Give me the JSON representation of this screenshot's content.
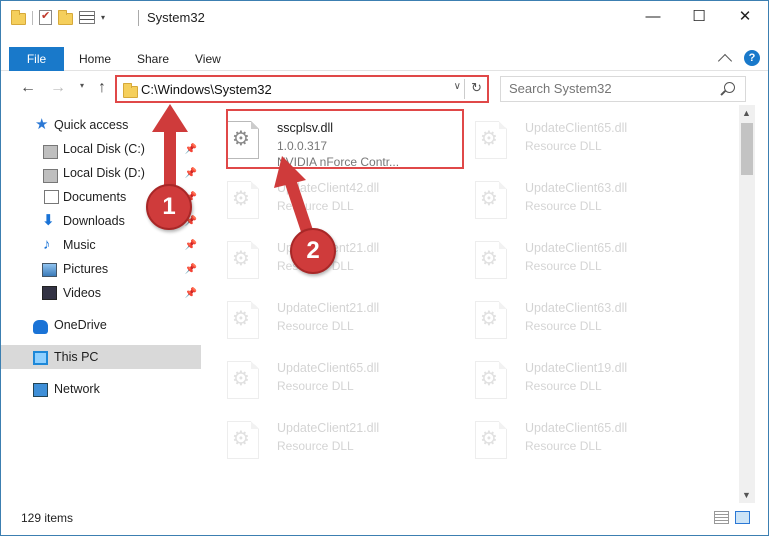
{
  "window": {
    "title": "System32"
  },
  "controls": {
    "minimize": "—",
    "maximize": "☐",
    "close": "✕"
  },
  "ribbon": {
    "tabs": [
      "File",
      "Home",
      "Share",
      "View"
    ],
    "help": "?"
  },
  "nav": {
    "back": "←",
    "forward": "→",
    "up": "↑",
    "dropdown": "▾"
  },
  "address": {
    "path": "C:\\Windows\\System32",
    "dropdown": "∨",
    "refresh": "↻"
  },
  "search": {
    "placeholder": "Search System32"
  },
  "sidebar": {
    "items": [
      {
        "label": "Quick access",
        "icon": "star-icon",
        "pinned": false
      },
      {
        "label": "Local Disk (C:)",
        "icon": "drive-icon",
        "pinned": true
      },
      {
        "label": "Local Disk (D:)",
        "icon": "drive-icon",
        "pinned": true
      },
      {
        "label": "Documents",
        "icon": "documents-icon",
        "pinned": true
      },
      {
        "label": "Downloads",
        "icon": "downloads-icon",
        "pinned": true
      },
      {
        "label": "Music",
        "icon": "music-icon",
        "pinned": true
      },
      {
        "label": "Pictures",
        "icon": "pictures-icon",
        "pinned": true
      },
      {
        "label": "Videos",
        "icon": "videos-icon",
        "pinned": true
      },
      {
        "label": "OneDrive",
        "icon": "onedrive-icon",
        "pinned": false
      },
      {
        "label": "This PC",
        "icon": "this-pc-icon",
        "pinned": false,
        "selected": true
      },
      {
        "label": "Network",
        "icon": "network-icon",
        "pinned": false
      }
    ],
    "pin_glyph": "📌"
  },
  "files": [
    {
      "name": "sscplsv.dll",
      "meta1": "1.0.0.317",
      "meta2": "NVIDIA nForce Contr...",
      "highlighted": true
    },
    {
      "name": "UpdateClient65.dll",
      "meta1": "Resource DLL"
    },
    {
      "name": "UpdateClient42.dll",
      "meta1": "Resource DLL"
    },
    {
      "name": "UpdateClient63.dll",
      "meta1": "Resource DLL"
    },
    {
      "name": "UpdateClient21.dll",
      "meta1": "Resource DLL"
    },
    {
      "name": "UpdateClient65.dll",
      "meta1": "Resource DLL"
    },
    {
      "name": "UpdateClient21.dll",
      "meta1": "Resource DLL"
    },
    {
      "name": "UpdateClient63.dll",
      "meta1": "Resource DLL"
    },
    {
      "name": "UpdateClient65.dll",
      "meta1": "Resource DLL"
    },
    {
      "name": "UpdateClient19.dll",
      "meta1": "Resource DLL"
    },
    {
      "name": "UpdateClient21.dll",
      "meta1": "Resource DLL"
    },
    {
      "name": "UpdateClient65.dll",
      "meta1": "Resource DLL"
    }
  ],
  "status": {
    "items_count": "129 items"
  },
  "scroll": {
    "up": "▲",
    "down": "▼"
  },
  "annotations": {
    "step1": "1",
    "step2": "2"
  },
  "colors": {
    "accent": "#1979ca",
    "annotation": "#cf3b3b",
    "selection": "#d9d9d9"
  }
}
